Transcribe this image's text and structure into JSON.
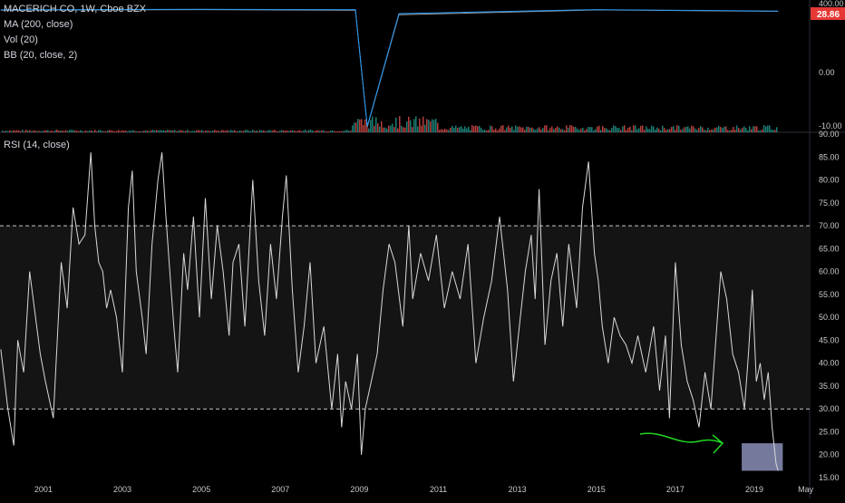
{
  "legend": {
    "symbol": "MACERICH CO, 1W, Cboe BZX",
    "ma": "MA (200, close)",
    "vol": "Vol (20)",
    "bb": "BB (20, close, 2)",
    "rsi": "RSI (14, close)"
  },
  "price_axis": {
    "ticks": [
      "400.00",
      "0.00",
      "-10.00"
    ],
    "last_price": "28.86",
    "last_price_color": "#e53935"
  },
  "colors": {
    "background": "#000000",
    "rsi_band": "#141414",
    "rsi_line": "#d9d9d9",
    "guide_line": "#c8c8c8",
    "highlight_box": "#8a8fb8",
    "arrow": "#22d822",
    "axis_text": "#c8c8c8",
    "volume_up": "#26a69a",
    "volume_down": "#ef5350"
  },
  "chart_data": [
    {
      "type": "line",
      "title": "RSI (14, close)",
      "ylim": [
        15,
        90
      ],
      "y_ticks": [
        "90.00",
        "85.00",
        "80.00",
        "75.00",
        "70.00",
        "65.00",
        "60.00",
        "55.00",
        "50.00",
        "45.00",
        "40.00",
        "35.00",
        "30.00",
        "25.00",
        "20.00",
        "15.00"
      ],
      "x_ticks": [
        "2001",
        "2003",
        "2005",
        "2007",
        "2009",
        "2011",
        "2013",
        "2015",
        "2017",
        "2019",
        "May"
      ],
      "xlim": [
        1999.9,
        2020.4
      ],
      "guide_levels": [
        30,
        70
      ],
      "band": [
        30,
        70
      ],
      "highlight_box": {
        "x": [
          2018.68,
          2019.72
        ],
        "y": [
          16.5,
          22.5
        ]
      },
      "series": [
        {
          "x": [
            1999.92,
            2000.1,
            2000.25,
            2000.35,
            2000.5,
            2000.65,
            2000.8,
            2000.92,
            2001.05,
            2001.25,
            2001.45,
            2001.6,
            2001.75,
            2001.9,
            2002.05,
            2002.2,
            2002.3,
            2002.4,
            2002.5,
            2002.6,
            2002.7,
            2002.85,
            2003.0,
            2003.15,
            2003.25,
            2003.35,
            2003.5,
            2003.6,
            2003.75,
            2003.9,
            2004.0,
            2004.1,
            2004.2,
            2004.3,
            2004.4,
            2004.55,
            2004.65,
            2004.8,
            2004.95,
            2005.1,
            2005.25,
            2005.4,
            2005.55,
            2005.7,
            2005.8,
            2005.95,
            2006.1,
            2006.3,
            2006.45,
            2006.6,
            2006.75,
            2006.9,
            2007.05,
            2007.15,
            2007.3,
            2007.45,
            2007.6,
            2007.75,
            2007.9,
            2008.1,
            2008.3,
            2008.45,
            2008.55,
            2008.65,
            2008.8,
            2008.95,
            2009.05,
            2009.15,
            2009.3,
            2009.45,
            2009.6,
            2009.75,
            2009.9,
            2010.1,
            2010.25,
            2010.35,
            2010.55,
            2010.75,
            2010.95,
            2011.15,
            2011.35,
            2011.55,
            2011.75,
            2011.95,
            2012.15,
            2012.35,
            2012.55,
            2012.75,
            2012.9,
            2013.05,
            2013.2,
            2013.35,
            2013.45,
            2013.55,
            2013.7,
            2013.85,
            2014.0,
            2014.15,
            2014.3,
            2014.5,
            2014.65,
            2014.8,
            2014.95,
            2015.05,
            2015.15,
            2015.3,
            2015.45,
            2015.6,
            2015.75,
            2015.9,
            2016.05,
            2016.25,
            2016.45,
            2016.6,
            2016.75,
            2016.85,
            2017.0,
            2017.15,
            2017.3,
            2017.45,
            2017.6,
            2017.75,
            2017.9,
            2018.05,
            2018.15,
            2018.3,
            2018.45,
            2018.6,
            2018.75,
            2018.85,
            2018.95,
            2019.05,
            2019.15,
            2019.25,
            2019.35,
            2019.45,
            2019.55,
            2019.6
          ],
          "y": [
            43,
            30,
            22,
            45,
            38,
            60,
            50,
            42,
            36,
            28,
            62,
            52,
            74,
            66,
            68,
            86,
            70,
            62,
            60,
            52,
            56,
            50,
            38,
            74,
            82,
            60,
            50,
            42,
            66,
            80,
            86,
            72,
            60,
            48,
            38,
            64,
            56,
            72,
            50,
            76,
            54,
            70,
            60,
            46,
            62,
            66,
            48,
            80,
            58,
            46,
            66,
            54,
            72,
            81,
            56,
            38,
            48,
            62,
            40,
            48,
            30,
            42,
            26,
            36,
            30,
            42,
            20,
            30,
            36,
            42,
            56,
            66,
            62,
            48,
            70,
            54,
            64,
            58,
            68,
            52,
            60,
            54,
            66,
            40,
            50,
            58,
            72,
            56,
            36,
            48,
            60,
            68,
            54,
            78,
            44,
            58,
            64,
            48,
            66,
            52,
            74,
            84,
            64,
            58,
            48,
            40,
            50,
            46,
            44,
            40,
            46,
            38,
            48,
            34,
            46,
            28,
            62,
            44,
            36,
            32,
            26,
            38,
            30,
            48,
            60,
            54,
            42,
            38,
            30,
            42,
            56,
            36,
            40,
            32,
            38,
            26,
            18,
            16.5
          ]
        }
      ]
    },
    {
      "type": "line",
      "title": "MACERICH CO, 1W, Cboe BZX",
      "note": "price pane with MA (200, close), BB (20, close, 2) and Vol (20); a single extreme spike near 2009 toward about -10",
      "series": [
        {
          "name": "MA (200, close)",
          "x": [
            1999.92,
            2005,
            2008.9,
            2009.2,
            2010,
            2015,
            2019.6
          ],
          "y": [
            396,
            398,
            396,
            -12,
            380,
            397,
            392
          ]
        },
        {
          "name": "BB (20, close, 2)",
          "x": [
            1999.92,
            2005,
            2008.9,
            2009.2,
            2010,
            2015,
            2019.6
          ],
          "y": [
            397,
            399,
            398,
            -10,
            384,
            398,
            393
          ]
        }
      ]
    }
  ]
}
